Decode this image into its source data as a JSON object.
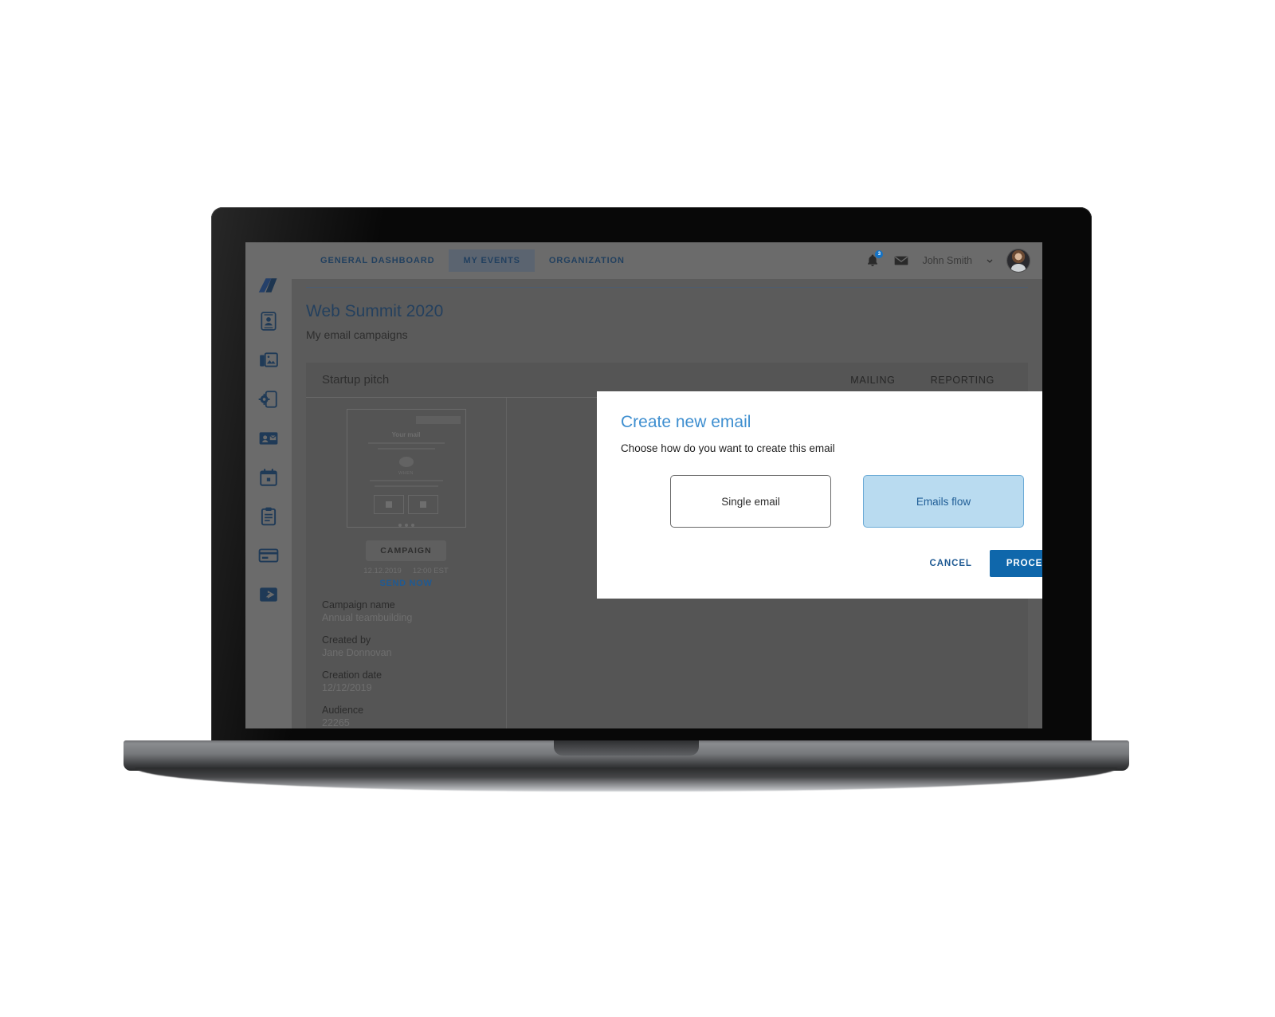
{
  "app": {
    "logo_name": "brand-logo"
  },
  "topnav": {
    "tabs": [
      {
        "label": "GENERAL DASHBOARD",
        "active": false
      },
      {
        "label": "MY EVENTS",
        "active": true
      },
      {
        "label": "ORGANIZATION",
        "active": false
      }
    ],
    "notifications_icon": "bell-icon",
    "notifications_count": "3",
    "messages_icon": "envelope-icon",
    "username": "John Smith",
    "chevron_icon": "chevron-down-icon",
    "avatar": "user-avatar"
  },
  "sidebar": {
    "items": [
      {
        "icon": "contact-card-icon",
        "label": "Contacts"
      },
      {
        "icon": "photo-gallery-icon",
        "label": "Gallery"
      },
      {
        "icon": "mobile-settings-icon",
        "label": "App settings"
      },
      {
        "icon": "badge-mail-icon",
        "label": "Attendees"
      },
      {
        "icon": "calendar-icon",
        "label": "Calendar"
      },
      {
        "icon": "clipboard-icon",
        "label": "Agenda"
      },
      {
        "icon": "credit-card-icon",
        "label": "Payments"
      },
      {
        "icon": "share-icon",
        "label": "Share"
      }
    ]
  },
  "page": {
    "title": "Web Summit 2020",
    "subtitle": "My email campaigns"
  },
  "card": {
    "title": "Startup pitch",
    "tabs": [
      {
        "label": "MAILING"
      },
      {
        "label": "REPORTING"
      }
    ]
  },
  "detail": {
    "thumb_title": "Your mail",
    "thumb_when": "WHEN",
    "campaign_pill": "CAMPAIGN",
    "schedule_date": "12.12.2019",
    "schedule_time": "12:00 EST",
    "send_now": "SEND NOW",
    "fields": [
      {
        "label": "Campaign name",
        "value": "Annual teambuilding"
      },
      {
        "label": "Created by",
        "value": "Jane Donnovan"
      },
      {
        "label": "Creation date",
        "value": "12/12/2019"
      },
      {
        "label": "Audience",
        "value": "22265"
      }
    ]
  },
  "modal": {
    "title": "Create new email",
    "subtitle": "Choose how do you want to create this email",
    "options": [
      {
        "label": "Single email",
        "selected": false
      },
      {
        "label": "Emails flow",
        "selected": true
      }
    ],
    "cancel_label": "CANCEL",
    "proceed_label": "PROCEED"
  },
  "colors": {
    "accent_blue": "#0f67ab",
    "modal_title_blue": "#3f8fd0",
    "selected_fill": "#b9dbf0",
    "selected_border": "#6aaad6",
    "link_blue": "#1f5a93",
    "brand_navy": "#1f3a57",
    "screen_bg": "#5b5b5b"
  }
}
